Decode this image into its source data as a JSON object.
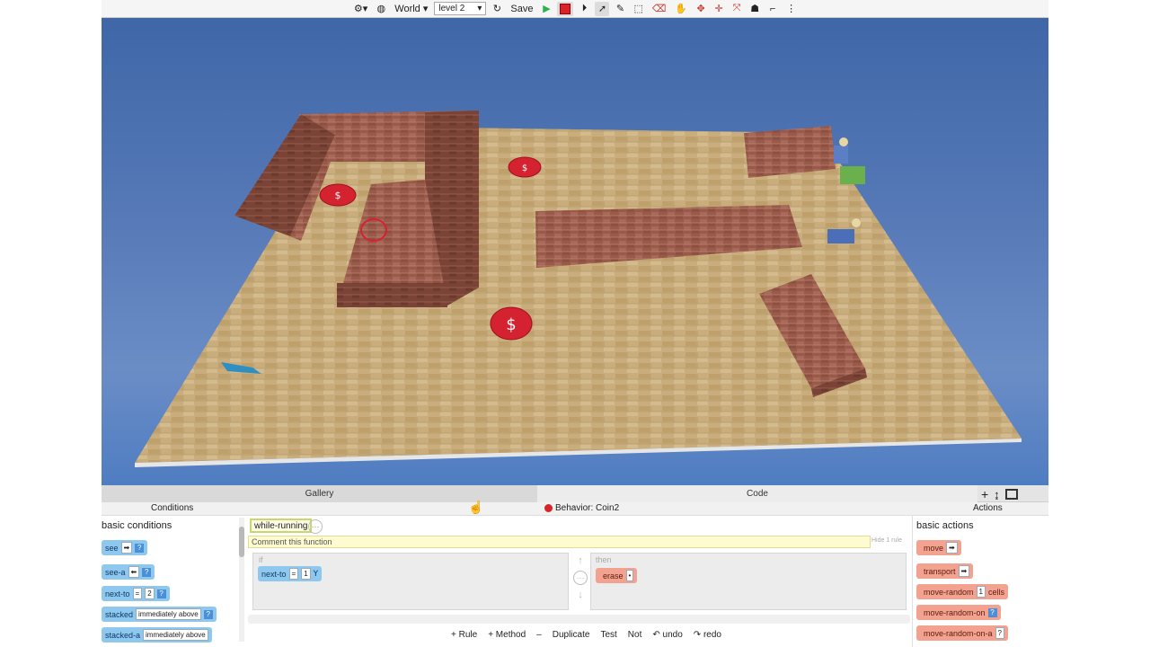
{
  "toolbar": {
    "world_label": "World",
    "level_value": "level 2",
    "save_label": "Save"
  },
  "tabs": {
    "gallery": "Gallery",
    "code": "Code"
  },
  "subheader": {
    "conditions": "Conditions",
    "behavior": "Behavior: Coin2",
    "actions": "Actions"
  },
  "conditions": {
    "title": "basic conditions",
    "items": [
      {
        "label": "see"
      },
      {
        "label": "see-a"
      },
      {
        "label": "next-to",
        "op": "=",
        "value": "2"
      },
      {
        "label": "stacked",
        "option": "immediately above"
      },
      {
        "label": "stacked-a",
        "option": "immediately above"
      }
    ]
  },
  "actions": {
    "title": "basic actions",
    "items": [
      {
        "label": "move"
      },
      {
        "label": "transport"
      },
      {
        "label": "move-random",
        "value": "1",
        "suffix": "cells"
      },
      {
        "label": "move-random-on"
      },
      {
        "label": "move-random-on-a"
      }
    ]
  },
  "editor": {
    "function_name": "while-running",
    "comment_placeholder": "Comment this function",
    "hide_rule": "Hide 1 rule",
    "if_label": "if",
    "then_label": "then",
    "condition": {
      "label": "next-to",
      "op": "=",
      "value": "1"
    },
    "action": {
      "label": "erase"
    }
  },
  "bottom_bar": {
    "add_rule": "+ Rule",
    "add_method": "+ Method",
    "remove": "–",
    "duplicate": "Duplicate",
    "test": "Test",
    "not": "Not",
    "undo": "undo",
    "redo": "redo"
  },
  "colors": {
    "condition_block": "#8fc8ee",
    "action_block": "#f2a28e",
    "behavior_dot": "#d9232a",
    "world_sky": "#4f7dc2"
  }
}
